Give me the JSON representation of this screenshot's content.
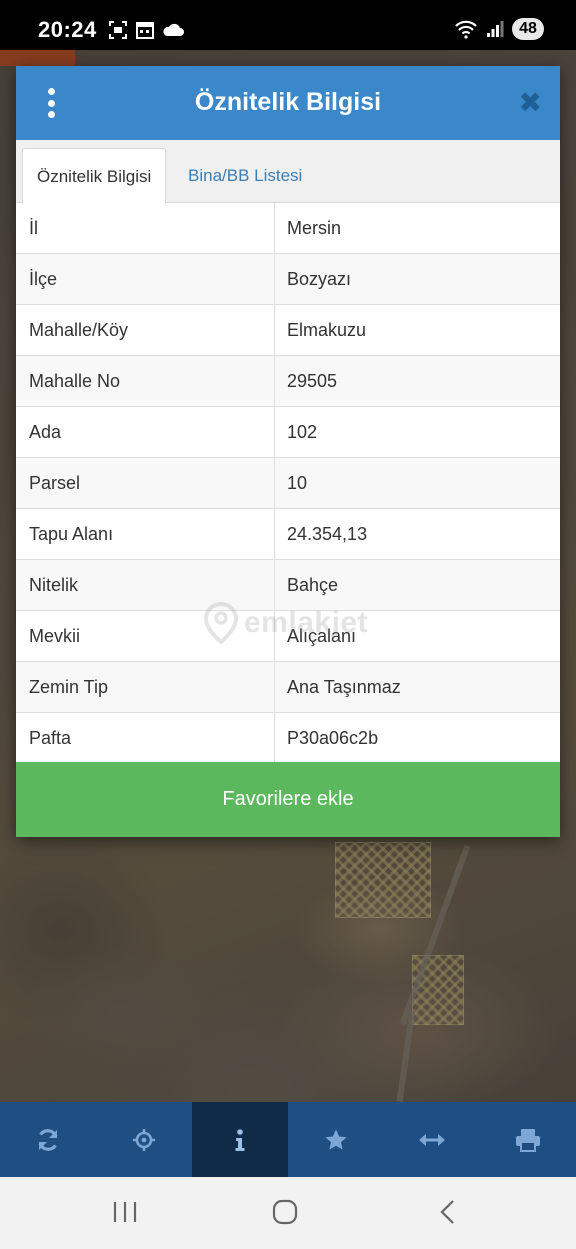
{
  "status_bar": {
    "time": "20:24",
    "battery": "48",
    "icons_left": [
      "screenshot-icon",
      "calendar-icon",
      "cloud-icon"
    ],
    "icons_right": [
      "wifi-icon",
      "signal-icon",
      "battery-icon"
    ]
  },
  "dialog": {
    "title": "Öznitelik Bilgisi",
    "tabs": [
      {
        "label": "Öznitelik Bilgisi",
        "active": true
      },
      {
        "label": "Bina/BB Listesi",
        "active": false
      }
    ],
    "rows": [
      {
        "key": "İl",
        "value": "Mersin"
      },
      {
        "key": "İlçe",
        "value": "Bozyazı"
      },
      {
        "key": "Mahalle/Köy",
        "value": "Elmakuzu"
      },
      {
        "key": "Mahalle No",
        "value": "29505"
      },
      {
        "key": "Ada",
        "value": "102"
      },
      {
        "key": "Parsel",
        "value": "10"
      },
      {
        "key": "Tapu Alanı",
        "value": "24.354,13"
      },
      {
        "key": "Nitelik",
        "value": "Bahçe"
      },
      {
        "key": "Mevkii",
        "value": "Alıçalanı"
      },
      {
        "key": "Zemin Tip",
        "value": "Ana Taşınmaz"
      },
      {
        "key": "Pafta",
        "value": "P30a06c2b"
      }
    ],
    "favorite_button": "Favorilere ekle"
  },
  "watermark": "emlakjet",
  "toolbar": {
    "items": [
      "refresh-icon",
      "locate-icon",
      "info-icon",
      "star-icon",
      "measure-icon",
      "print-icon"
    ],
    "active": "info-icon"
  },
  "navbar": [
    "recent-apps-icon",
    "home-icon",
    "back-icon"
  ],
  "colors": {
    "header_blue": "#3a87c9",
    "tab_link": "#3a7fb8",
    "favorite_green": "#5cb85c",
    "toolbar_blue": "#1f4f82",
    "toolbar_active": "#0f2b47"
  }
}
